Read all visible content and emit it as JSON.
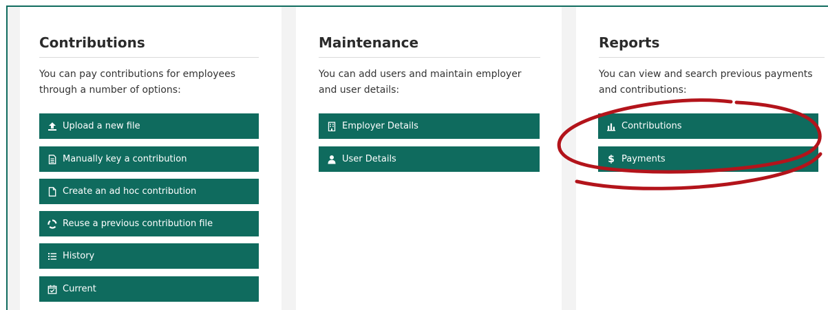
{
  "colors": {
    "brand": "#0f6b5e",
    "annotation": "#b3141b"
  },
  "contributions": {
    "title": "Contributions",
    "description": "You can pay contributions for employees through a number of options:",
    "buttons": [
      {
        "label": "Upload a new file",
        "icon": "upload-icon"
      },
      {
        "label": "Manually key a contribution",
        "icon": "document-lines-icon"
      },
      {
        "label": "Create an ad hoc contribution",
        "icon": "blank-file-icon"
      },
      {
        "label": "Reuse a previous contribution file",
        "icon": "recycle-icon"
      },
      {
        "label": "History",
        "icon": "list-icon"
      },
      {
        "label": "Current",
        "icon": "calendar-check-icon"
      }
    ]
  },
  "maintenance": {
    "title": "Maintenance",
    "description": "You can add users and maintain employer and user details:",
    "buttons": [
      {
        "label": "Employer Details",
        "icon": "building-icon"
      },
      {
        "label": "User Details",
        "icon": "user-icon"
      }
    ]
  },
  "reports": {
    "title": "Reports",
    "description": "You can view and search previous payments and contributions:",
    "buttons": [
      {
        "label": "Contributions",
        "icon": "bar-chart-icon"
      },
      {
        "label": "Payments",
        "icon": "dollar-icon"
      }
    ]
  }
}
